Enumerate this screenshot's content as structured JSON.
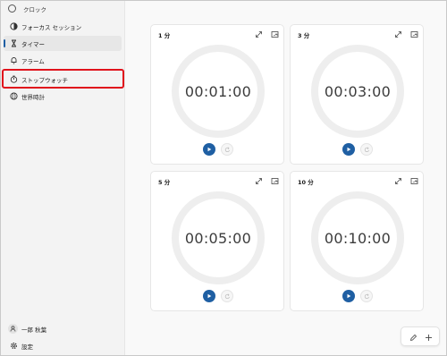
{
  "app": {
    "title": "クロック"
  },
  "window_controls": {
    "minimize": "—",
    "maximize": "☐",
    "close": "✕"
  },
  "sidebar": {
    "items": [
      {
        "label": "フォーカス セッション",
        "icon": "focus-session-icon"
      },
      {
        "label": "タイマー",
        "icon": "hourglass-icon",
        "selected": true
      },
      {
        "label": "アラーム",
        "icon": "bell-icon"
      },
      {
        "label": "ストップウォッチ",
        "icon": "stopwatch-icon",
        "highlighted": true
      },
      {
        "label": "世界時計",
        "icon": "globe-icon"
      }
    ],
    "user": {
      "name": "一郎 秋葉",
      "icon": "person-icon"
    },
    "settings": {
      "label": "設定",
      "icon": "gear-icon"
    }
  },
  "timers": [
    {
      "title": "1 分",
      "time": "00:01:00"
    },
    {
      "title": "3 分",
      "time": "00:03:00"
    },
    {
      "title": "5 分",
      "time": "00:05:00"
    },
    {
      "title": "10 分",
      "time": "00:10:00"
    }
  ],
  "colors": {
    "accent": "#1f5fa3",
    "highlight": "#e0131c"
  }
}
